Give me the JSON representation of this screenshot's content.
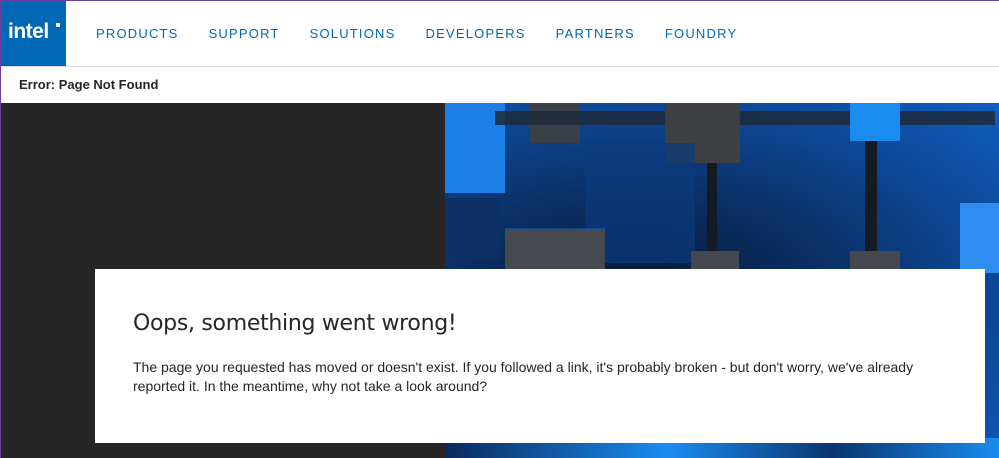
{
  "brand": {
    "logo_text": "intel",
    "accent": "#0068b5"
  },
  "nav": {
    "items": [
      "PRODUCTS",
      "SUPPORT",
      "SOLUTIONS",
      "DEVELOPERS",
      "PARTNERS",
      "FOUNDRY"
    ]
  },
  "breadcrumb": {
    "label": "Error: Page Not Found"
  },
  "error": {
    "title": "Oops, something went wrong!",
    "message": "The page you requested has moved or doesn't exist. If you followed a link, it's probably broken - but don't worry, we've already reported it. In the meantime, why not take a look around?"
  },
  "colors": {
    "hero_dark": "#262626",
    "hero_blue": "#0068b5",
    "text": "#262626"
  }
}
